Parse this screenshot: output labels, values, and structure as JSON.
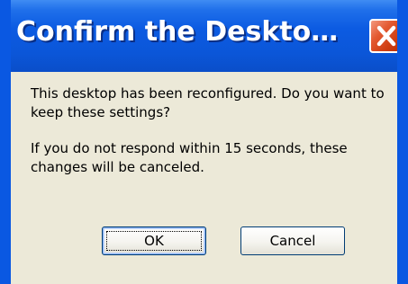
{
  "window": {
    "title": "Confirm the Deskto…",
    "close_icon": "close-x-icon",
    "colors": {
      "titlebar": "#0c5be2",
      "close_button": "#d7441a",
      "body": "#ece9d8"
    }
  },
  "dialog": {
    "message_line1": "This desktop has been reconfigured.  Do you want to keep these settings?",
    "message_line2": "If you do not respond within 15 seconds, these changes will be canceled."
  },
  "buttons": {
    "ok_label": "OK",
    "cancel_label": "Cancel"
  }
}
